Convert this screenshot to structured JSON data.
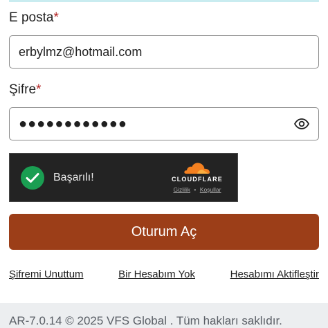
{
  "email_field": {
    "label": "E posta",
    "required_mark": "*",
    "value": "erbylmz@hotmail.com"
  },
  "password_field": {
    "label": "Şifre",
    "required_mark": "*",
    "masked_value": "●●●●●●●●●●●●",
    "toggle_icon": "eye-icon"
  },
  "captcha": {
    "status": "Başarılı!",
    "brand": "CLOUDFLARE",
    "privacy_link": "Gizlilik",
    "separator": "•",
    "terms_link": "Koşullar",
    "brand_color": "#f38020",
    "success_color": "#1a9e52"
  },
  "login_button": {
    "label": "Oturum Aç",
    "color": "#9c3e18"
  },
  "links": {
    "forgot_password": "Şifremi Unuttum",
    "no_account": "Bir Hesabım Yok",
    "activate_account": "Hesabımı Aktifleştir"
  },
  "footer": {
    "text": "AR-7.0.14 © 2025 VFS Global . Tüm hakları saklıdır."
  }
}
